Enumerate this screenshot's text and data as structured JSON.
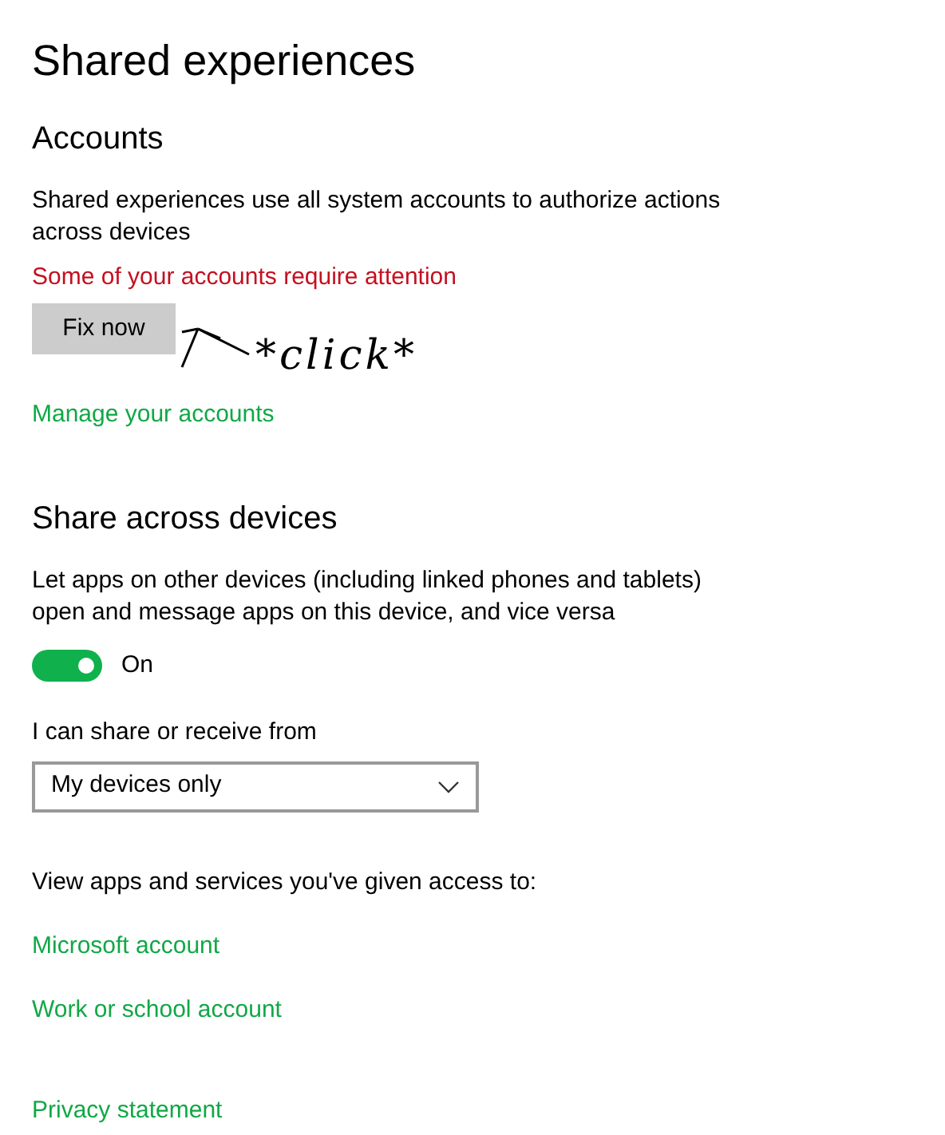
{
  "title": "Shared experiences",
  "accounts": {
    "heading": "Accounts",
    "description": "Shared experiences use all system accounts to authorize actions across devices",
    "warning": "Some of your accounts require attention",
    "fix_button": "Fix now",
    "annotation": "*click*",
    "link": "Manage your accounts"
  },
  "share": {
    "heading": "Share across devices",
    "description": "Let apps on other devices (including linked phones and tablets) open and message apps on this device, and vice versa",
    "toggle": {
      "on": true,
      "label": "On"
    },
    "dropdown_label": "I can share or receive from",
    "dropdown_value": "My devices only",
    "access_text": "View apps and services you've given access to:",
    "links": [
      "Microsoft account",
      "Work or school account"
    ]
  },
  "privacy_link": "Privacy statement"
}
